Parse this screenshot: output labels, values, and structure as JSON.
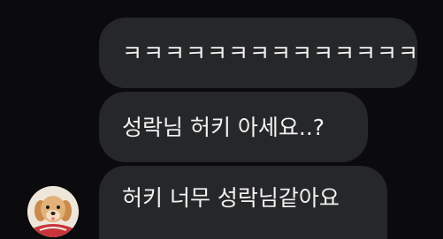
{
  "messages": [
    {
      "text": "ㅋㅋㅋㅋㅋㅋㅋㅋㅋㅋㅋㅋㅋㅋ"
    },
    {
      "text": "성락님 허키 아세요..?"
    },
    {
      "text": "허키 너무 성락님같아요"
    }
  ],
  "avatar": {
    "icon": "puppy-avatar-icon"
  },
  "colors": {
    "background": "#0b0b0d",
    "bubble": "#262729",
    "text": "#f2f2f2"
  }
}
